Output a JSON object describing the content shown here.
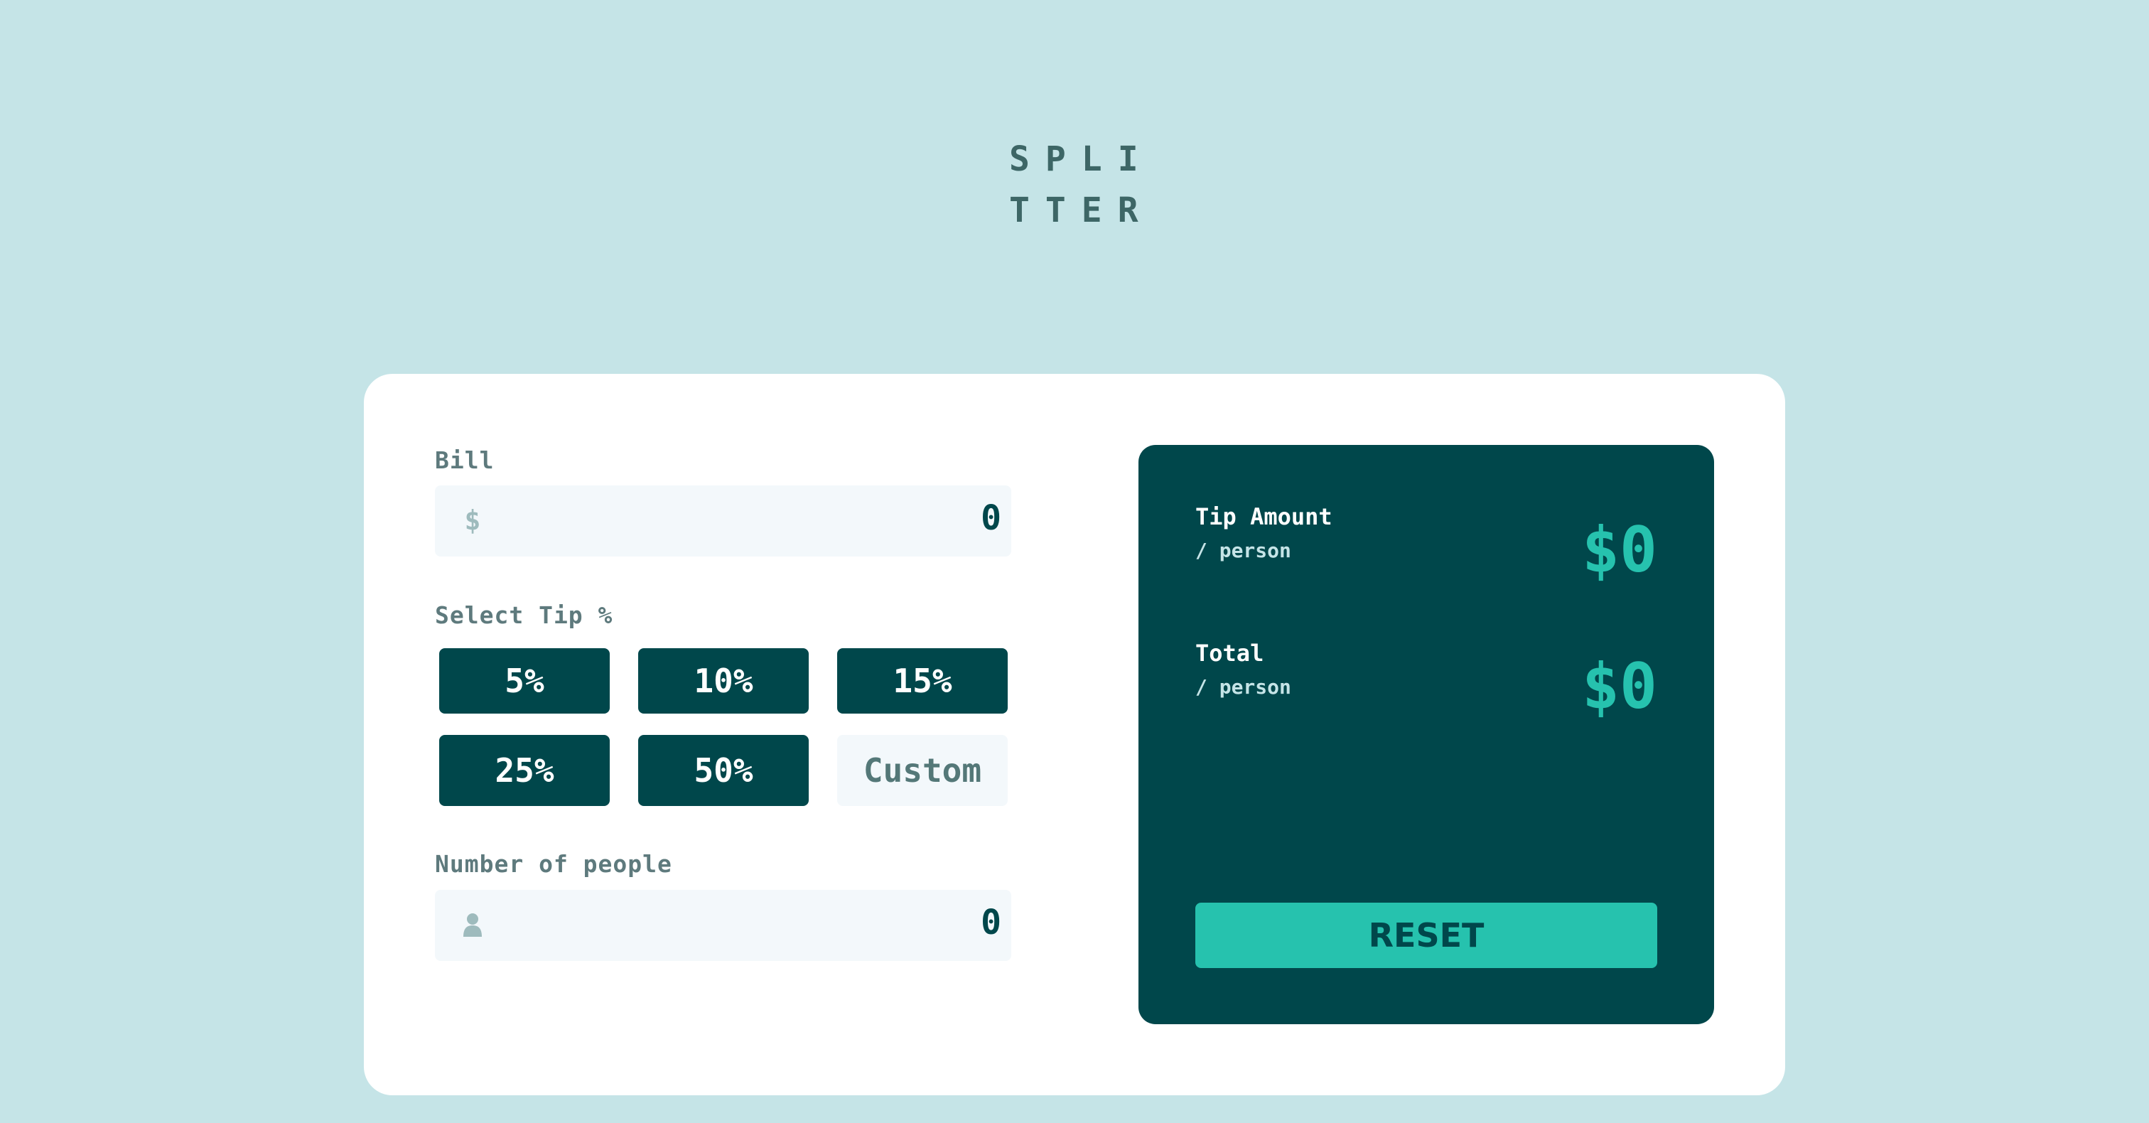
{
  "logo": {
    "line1": "SPLI",
    "line2": "TTER"
  },
  "bill": {
    "label": "Bill",
    "value": "0",
    "icon": "dollar-icon",
    "icon_glyph": "$"
  },
  "tip": {
    "label": "Select Tip %",
    "options": [
      "5%",
      "10%",
      "15%",
      "25%",
      "50%"
    ],
    "custom_placeholder": "Custom"
  },
  "people": {
    "label": "Number of people",
    "value": "0",
    "icon": "person-icon"
  },
  "results": {
    "tip_amount_title": "Tip Amount",
    "tip_amount_sub": "/ person",
    "tip_amount_value": "$0",
    "total_title": "Total",
    "total_sub": "/ person",
    "total_value": "$0",
    "reset_label": "RESET"
  },
  "colors": {
    "background": "#c5e4e7",
    "dark_cyan": "#00474b",
    "accent": "#26c2ae",
    "input_bg": "#f3f8fb"
  }
}
